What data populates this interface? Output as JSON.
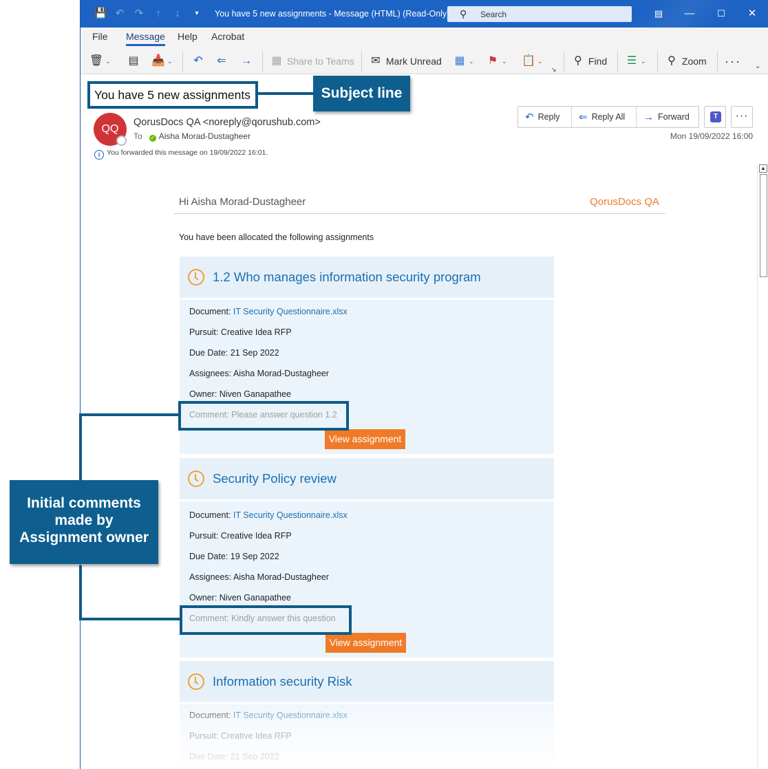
{
  "window": {
    "title": "You have 5 new assignments  -  Message (HTML) (Read-Only)",
    "search_placeholder": "Search"
  },
  "menu": {
    "tabs": [
      "File",
      "Message",
      "Help",
      "Acrobat"
    ],
    "active_tab": "Message"
  },
  "ribbon": {
    "share_to_teams": "Share to Teams",
    "mark_unread": "Mark Unread",
    "find": "Find",
    "zoom": "Zoom"
  },
  "message": {
    "subject": "You have 5 new assignments",
    "avatar_initials": "QQ",
    "sender": "QorusDocs QA <noreply@qorushub.com>",
    "to_label": "To",
    "recipient": "Aisha Morad-Dustagheer",
    "forward_info": "You forwarded this message on 19/09/2022 16:01.",
    "datetime": "Mon 19/09/2022 16:00",
    "actions": {
      "reply": "Reply",
      "reply_all": "Reply All",
      "forward": "Forward"
    }
  },
  "body": {
    "greeting": "Hi Aisha Morad-Dustagheer",
    "brand": "QorusDocs QA",
    "intro": "You have been allocated the following assignments",
    "view_button": "View assignment",
    "labels": {
      "document": "Document: ",
      "pursuit": "Pursuit: ",
      "due_date": "Due Date: ",
      "assignees": "Assignees: ",
      "owner": "Owner: ",
      "comment": "Comment: "
    },
    "assignments": [
      {
        "title": "1.2 Who manages information security program",
        "document": "IT Security Questionnaire.xlsx",
        "pursuit": "Creative Idea RFP",
        "due_date": "21 Sep 2022",
        "assignees": "Aisha Morad-Dustagheer",
        "owner": "Niven Ganapathee",
        "comment": "Please answer question 1.2"
      },
      {
        "title": "Security Policy review",
        "document": "IT Security Questionnaire.xlsx",
        "pursuit": "Creative Idea RFP",
        "due_date": "19 Sep 2022",
        "assignees": "Aisha Morad-Dustagheer",
        "owner": "Niven Ganapathee",
        "comment": "Kindly answer this question"
      },
      {
        "title": "Information security Risk",
        "document": "IT Security Questionnaire.xlsx",
        "pursuit": "Creative Idea RFP",
        "due_date": "21 Sep 2022"
      }
    ]
  },
  "annotations": {
    "subject_line": "Subject line",
    "initial_comments_1": "Initial comments",
    "initial_comments_2": "made by",
    "initial_comments_3": "Assignment owner"
  },
  "colors": {
    "titlebar": "#1d63c4",
    "accent_orange": "#ef7b28",
    "link_blue": "#1a6fb0",
    "card_header": "#e6f0f9",
    "callout": "#0e5f8f"
  }
}
